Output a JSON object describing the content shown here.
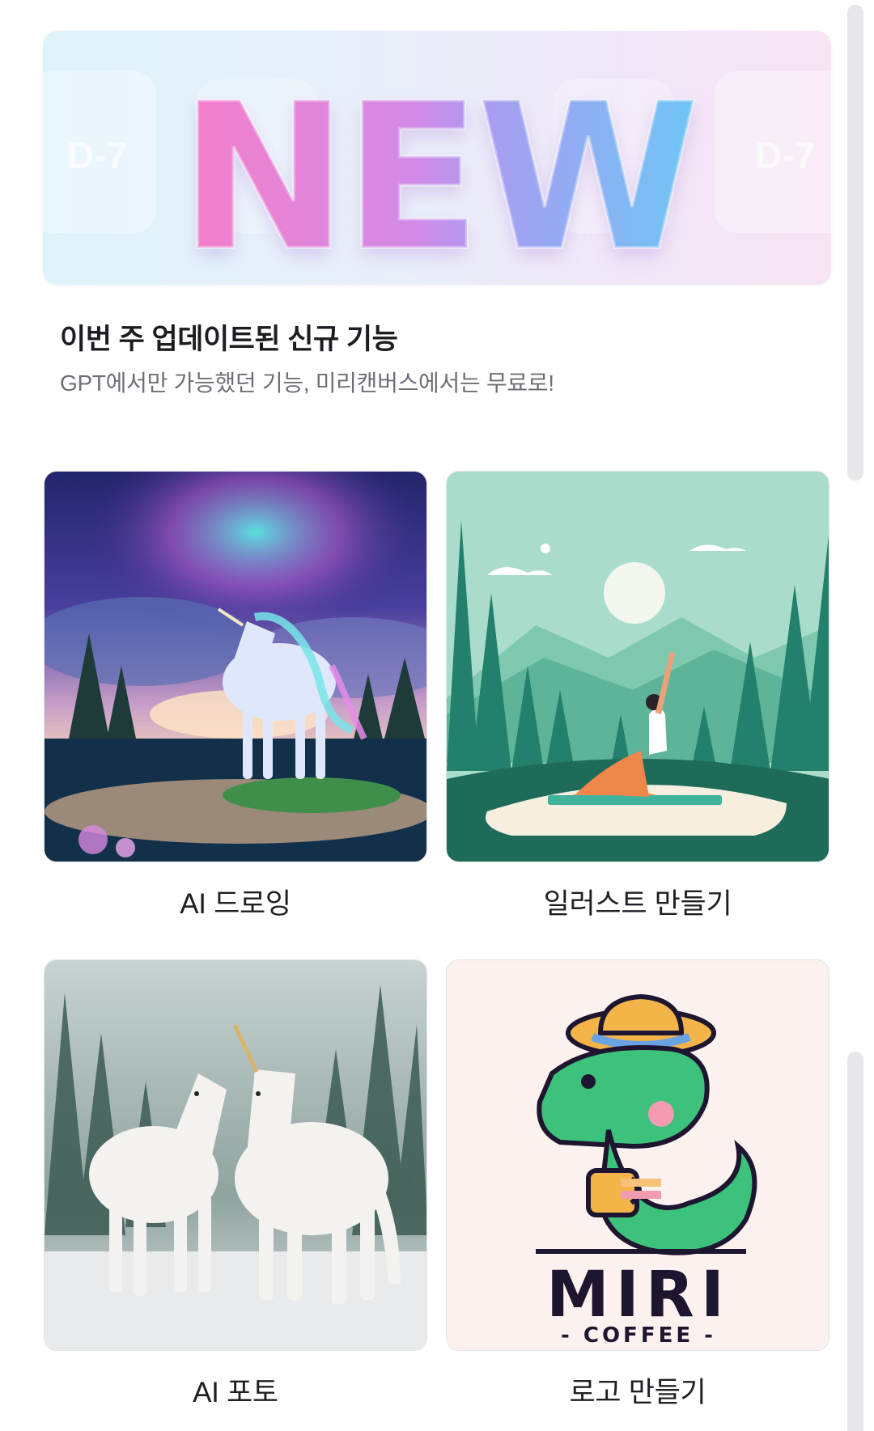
{
  "banner": {
    "art_text": "NEW",
    "side_text": "D-7",
    "title": "이번 주 업데이트된 신규 기능",
    "subtitle": "GPT에서만 가능했던 기능, 미리캔버스에서는 무료로!"
  },
  "cards": [
    {
      "label": "AI 드로잉",
      "image": "fantasy-unicorn-illustration"
    },
    {
      "label": "일러스트 만들기",
      "image": "yoga-forest-illustration"
    },
    {
      "label": "AI 포토",
      "image": "white-horses-photo"
    },
    {
      "label": "로고 만들기",
      "image": "miri-coffee-logo",
      "logo_text": "MIRI",
      "logo_sub": "- COFFEE -"
    }
  ],
  "colors": {
    "accent_pink": "#f47fc6",
    "accent_blue": "#6cc3f3",
    "text_primary": "#1c1c22",
    "text_secondary": "#6d6f78"
  }
}
